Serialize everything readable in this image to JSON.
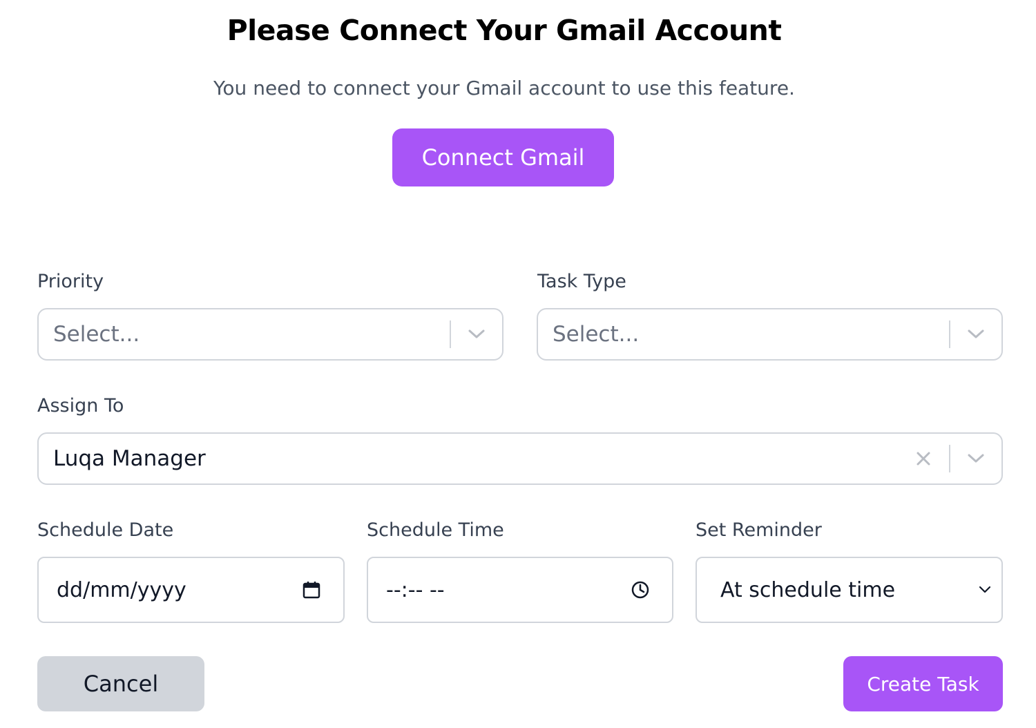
{
  "header": {
    "title": "Please Connect Your Gmail Account",
    "subtitle": "You need to connect your Gmail account to use this feature.",
    "connect_label": "Connect Gmail"
  },
  "form": {
    "priority": {
      "label": "Priority",
      "placeholder": "Select..."
    },
    "task_type": {
      "label": "Task Type",
      "placeholder": "Select..."
    },
    "assign_to": {
      "label": "Assign To",
      "value": "Luqa Manager"
    },
    "schedule_date": {
      "label": "Schedule Date",
      "value": "dd/mm/yyyy"
    },
    "schedule_time": {
      "label": "Schedule Time",
      "value": "--:-- --"
    },
    "set_reminder": {
      "label": "Set Reminder",
      "value": "At schedule time"
    }
  },
  "actions": {
    "cancel_label": "Cancel",
    "create_label": "Create Task"
  },
  "colors": {
    "accent": "#a855f7",
    "border": "#d1d5db",
    "cancel_bg": "#d1d5db"
  },
  "icons": {
    "dropdown": "chevron-down-icon",
    "clear": "close-icon",
    "date": "calendar-icon",
    "time": "clock-icon"
  }
}
